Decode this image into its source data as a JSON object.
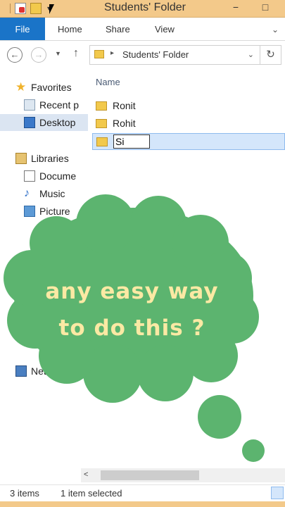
{
  "window": {
    "title": "Students' Folder",
    "min_glyph": "−",
    "max_glyph": "□"
  },
  "ribbon": {
    "tabs": [
      "File",
      "Home",
      "Share",
      "View"
    ],
    "expand_glyph": "⌄"
  },
  "address": {
    "back_glyph": "←",
    "forward_glyph": "→",
    "recent_glyph": "▼",
    "up_glyph": "↑",
    "separator_glyph": "▸",
    "path": "Students' Folder",
    "dropdown_glyph": "⌄",
    "refresh_glyph": "↻"
  },
  "nav": {
    "favorites": "Favorites",
    "recent": "Recent p",
    "desktop": "Desktop",
    "libraries": "Libraries",
    "documents": "Docume",
    "music": "Music",
    "pictures": "Picture",
    "network": "Netwo"
  },
  "content": {
    "column_name": "Name",
    "items": [
      "Ronit",
      "Rohit"
    ],
    "rename_value": "Si"
  },
  "scrollbar": {
    "left_glyph": "<"
  },
  "status": {
    "count": "3 items",
    "selection": "1 item selected"
  },
  "overlay": {
    "line1": "any easy way",
    "line2": "to do this ?",
    "bubble_color": "#5cb46f",
    "text_color": "#fbe9a4"
  },
  "colors": {
    "titlebar": "#f3c98a",
    "file_tab": "#1a74c8",
    "selection": "#d4e6fb"
  }
}
